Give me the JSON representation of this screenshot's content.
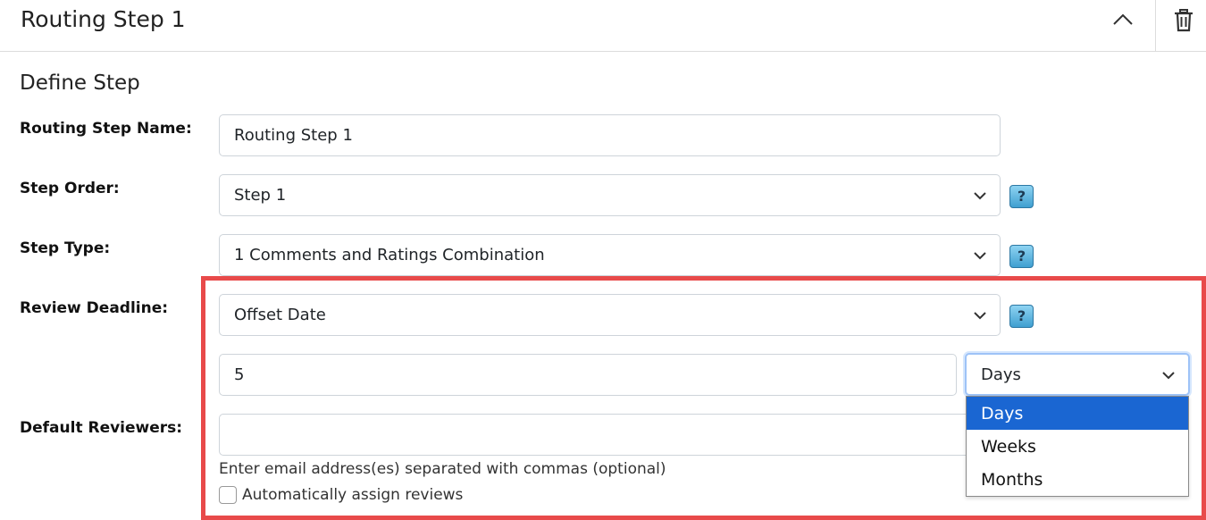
{
  "header": {
    "title": "Routing Step 1",
    "collapse_icon": "chevron-up-icon",
    "delete_icon": "trash-icon"
  },
  "section": {
    "title": "Define Step"
  },
  "form": {
    "routing_step_name": {
      "label": "Routing Step Name:",
      "value": "Routing Step 1"
    },
    "step_order": {
      "label": "Step Order:",
      "selected": "Step 1",
      "help": "?"
    },
    "step_type": {
      "label": "Step Type:",
      "selected": "1 Comments and Ratings Combination",
      "help": "?"
    },
    "review_deadline": {
      "label": "Review Deadline:",
      "selected": "Offset Date",
      "help": "?",
      "offset_value": "5",
      "unit_selected": "Days",
      "unit_options": [
        "Days",
        "Weeks",
        "Months"
      ]
    },
    "default_reviewers": {
      "label": "Default Reviewers:",
      "value": "",
      "hint": "Enter email address(es) separated with commas (optional)",
      "auto_assign_label": "Automatically assign reviews"
    }
  },
  "colors": {
    "highlight": "#e84a4a",
    "dropdown_selected": "#1a66d2"
  }
}
